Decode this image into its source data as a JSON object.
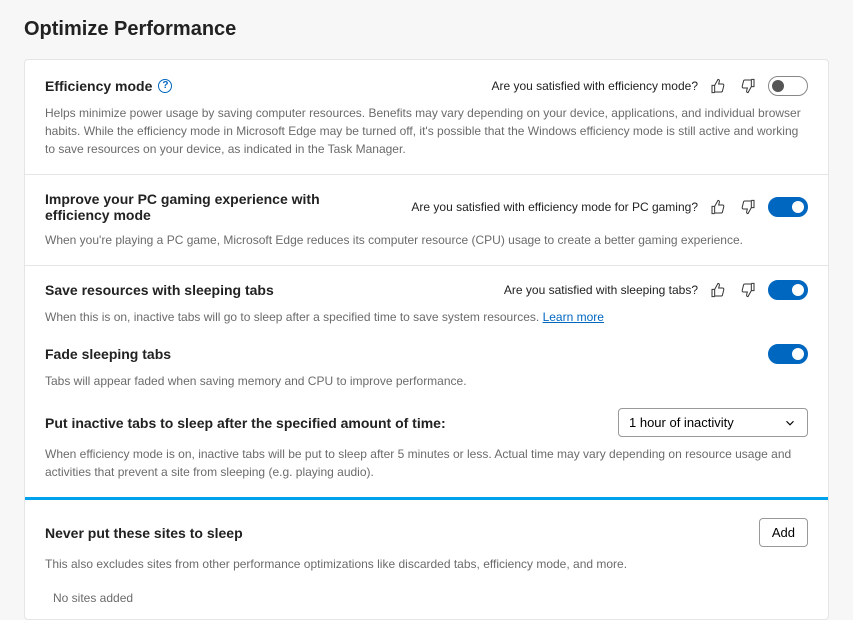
{
  "page": {
    "title": "Optimize Performance"
  },
  "sections": {
    "efficiency": {
      "title": "Efficiency mode",
      "prompt": "Are you satisfied with efficiency mode?",
      "toggle": "off",
      "desc": "Helps minimize power usage by saving computer resources. Benefits may vary depending on your device, applications, and individual browser habits. While the efficiency mode in Microsoft Edge may be turned off, it's possible that the Windows efficiency mode is still active and working to save resources on your device, as indicated in the Task Manager."
    },
    "gaming": {
      "title": "Improve your PC gaming experience with efficiency mode",
      "prompt": "Are you satisfied with efficiency mode for PC gaming?",
      "toggle": "on",
      "desc": "When you're playing a PC game, Microsoft Edge reduces its computer resource (CPU) usage to create a better gaming experience."
    },
    "sleeping": {
      "title": "Save resources with sleeping tabs",
      "prompt": "Are you satisfied with sleeping tabs?",
      "toggle": "on",
      "desc_pre": "When this is on, inactive tabs will go to sleep after a specified time to save system resources. ",
      "learn_more": "Learn more"
    },
    "fade": {
      "title": "Fade sleeping tabs",
      "toggle": "on",
      "desc": "Tabs will appear faded when saving memory and CPU to improve performance."
    },
    "inactive": {
      "title": "Put inactive tabs to sleep after the specified amount of time:",
      "selected": "1 hour of inactivity",
      "desc": "When efficiency mode is on, inactive tabs will be put to sleep after 5 minutes or less. Actual time may vary depending on resource usage and activities that prevent a site from sleeping (e.g. playing audio)."
    },
    "never": {
      "title": "Never put these sites to sleep",
      "add_label": "Add",
      "desc": "This also excludes sites from other performance optimizations like discarded tabs, efficiency mode, and more.",
      "empty": "No sites added"
    }
  }
}
